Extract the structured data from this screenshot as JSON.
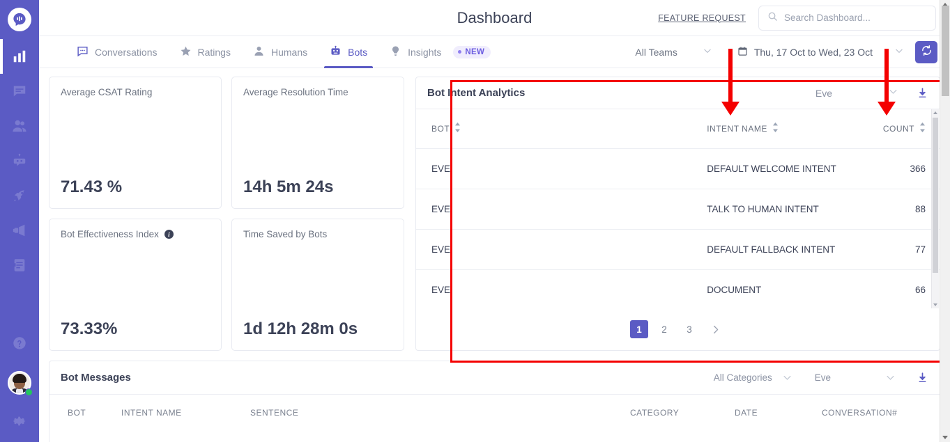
{
  "sidebar": {
    "logo_icon": "chat-bubble-logo",
    "items": [
      {
        "icon": "bar-chart-icon",
        "name": "analytics",
        "active": true
      },
      {
        "icon": "chat-message-icon",
        "name": "conversations",
        "active": false
      },
      {
        "icon": "users-icon",
        "name": "humans",
        "active": false
      },
      {
        "icon": "bot-icon",
        "name": "bots",
        "active": false
      },
      {
        "icon": "rocket-icon",
        "name": "campaigns",
        "active": false
      },
      {
        "icon": "megaphone-icon",
        "name": "broadcast",
        "active": false
      },
      {
        "icon": "document-icon",
        "name": "knowledge-base",
        "active": false
      }
    ],
    "help_icon": "question-circle-icon",
    "avatar_status": "online",
    "settings_icon": "gear-icon"
  },
  "header": {
    "title": "Dashboard",
    "feature_request": "FEATURE REQUEST",
    "search_placeholder": "Search Dashboard...",
    "search_value": "",
    "search_icon": "search-icon"
  },
  "tabs": [
    {
      "label": "Conversations",
      "icon": "chat-icon",
      "active": false
    },
    {
      "label": "Ratings",
      "icon": "star-icon",
      "active": false
    },
    {
      "label": "Humans",
      "icon": "person-icon",
      "active": false
    },
    {
      "label": "Bots",
      "icon": "robot-icon",
      "active": true
    },
    {
      "label": "Insights",
      "icon": "lightbulb-icon",
      "active": false,
      "badge": "NEW"
    }
  ],
  "filters": {
    "team": "All Teams",
    "date_range": "Thu, 17 Oct to Wed, 23 Oct",
    "calendar_icon": "calendar-icon",
    "refresh_icon": "refresh-icon"
  },
  "kpi_cards": [
    {
      "title": "Average CSAT Rating",
      "value": "71.43 %",
      "has_info": false
    },
    {
      "title": "Average Resolution Time",
      "value": "14h 5m 24s",
      "has_info": false
    },
    {
      "title": "Bot Effectiveness Index",
      "value": "73.33%",
      "has_info": true
    },
    {
      "title": "Time Saved by Bots",
      "value": "1d 12h 28m 0s",
      "has_info": false
    }
  ],
  "intent_panel": {
    "title": "Bot Intent Analytics",
    "bot_filter": "Eve",
    "download_icon": "download-icon",
    "columns": [
      {
        "label": "BOT",
        "sortable": true
      },
      {
        "label": "INTENT NAME",
        "sortable": true
      },
      {
        "label": "COUNT",
        "sortable": true
      }
    ],
    "rows": [
      {
        "bot": "EVE",
        "intent": "DEFAULT WELCOME INTENT",
        "count": "366"
      },
      {
        "bot": "EVE",
        "intent": "TALK TO HUMAN INTENT",
        "count": "88"
      },
      {
        "bot": "EVE",
        "intent": "DEFAULT FALLBACK INTENT",
        "count": "77"
      },
      {
        "bot": "EVE",
        "intent": "DOCUMENT",
        "count": "66"
      }
    ],
    "pagination": {
      "pages": [
        "1",
        "2",
        "3"
      ],
      "current": "1",
      "next_icon": "chevron-right-icon"
    }
  },
  "bot_messages": {
    "title": "Bot Messages",
    "category_filter": "All Categories",
    "bot_filter": "Eve",
    "download_icon": "download-icon",
    "columns": [
      "BOT",
      "INTENT NAME",
      "SENTENCE",
      "CATEGORY",
      "DATE",
      "CONVERSATION#"
    ]
  },
  "annotations": {
    "highlight_color": "#f40000",
    "arrows": [
      "intent-name-column-arrow",
      "count-column-arrow"
    ],
    "box": "bot-intent-analytics-highlight"
  },
  "colors": {
    "brand": "#5b5bc4",
    "sidebar": "#5b5bc4",
    "text": "#3c4257",
    "muted": "#8b92a3",
    "annotation": "#f40000"
  }
}
